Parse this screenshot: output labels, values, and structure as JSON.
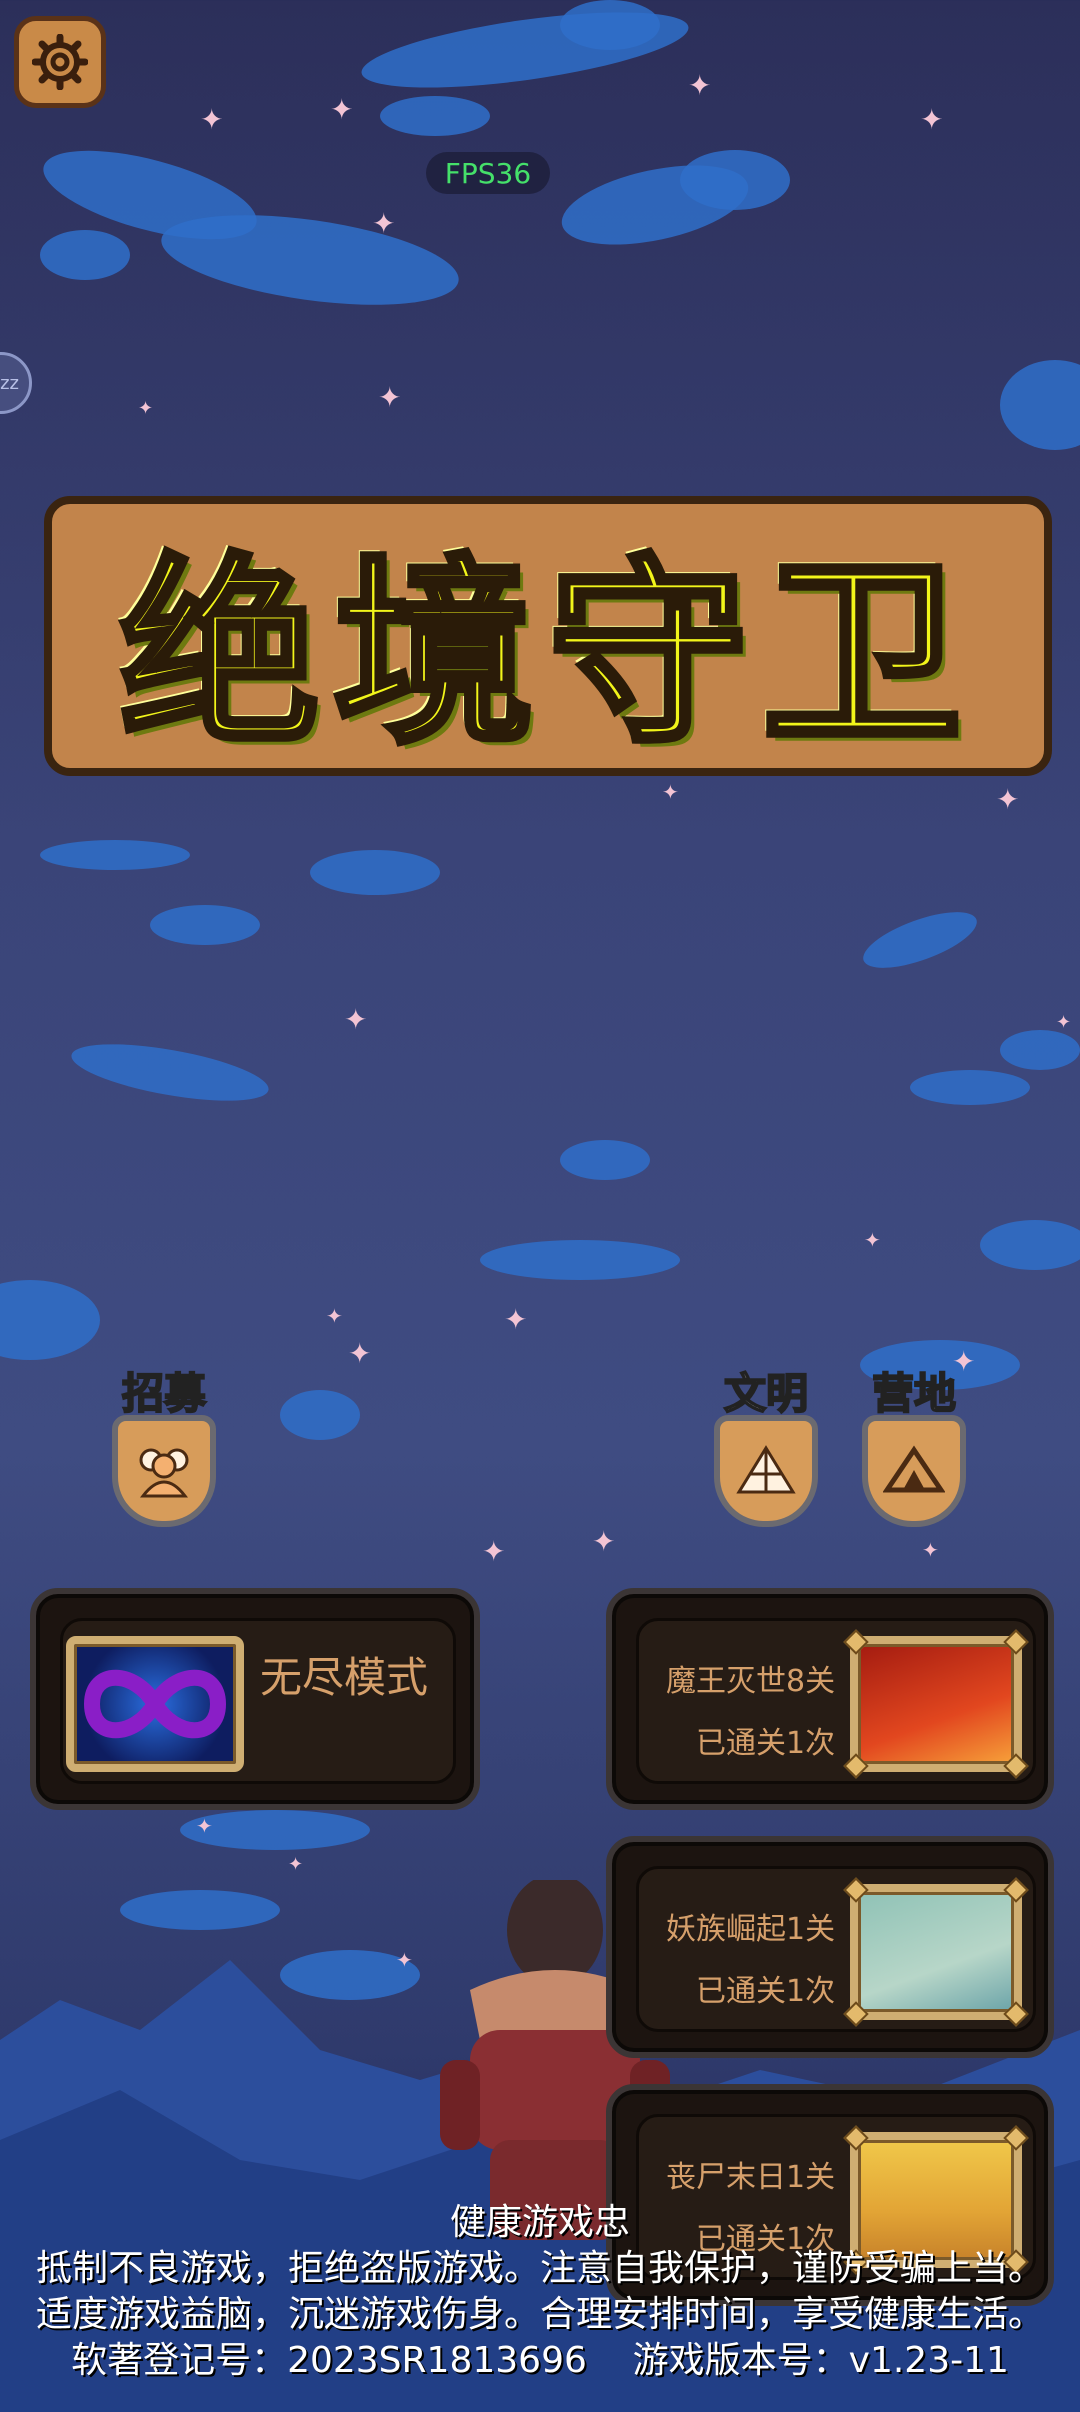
{
  "hud": {
    "fps": "FPS36",
    "side_bubble": "zz"
  },
  "title": "绝境守卫",
  "menu": [
    {
      "label": "招募",
      "icon": "recruit-icon"
    },
    {
      "label": "文明",
      "icon": "civilization-icon"
    },
    {
      "label": "营地",
      "icon": "camp-icon"
    }
  ],
  "endless": {
    "label": "无尽模式",
    "icon": "infinity-icon"
  },
  "stages": [
    {
      "name": "魔王灭世8关",
      "cleared": "已通关1次",
      "thumb": "fire-scene-icon"
    },
    {
      "name": "妖族崛起1关",
      "cleared": "已通关1次",
      "thumb": "map-scene-icon"
    },
    {
      "name": "丧尸末日1关",
      "cleared": "已通关1次",
      "thumb": "desert-road-icon"
    }
  ],
  "footer": {
    "heading": "健康游戏忠",
    "line1": "抵制不良游戏，拒绝盗版游戏。注意自我保护，谨防受骗上当。",
    "line2": "适度游戏益脑，沉迷游戏伤身。合理安排时间，享受健康生活。",
    "line3": "软著登记号：2023SR1813696    游戏版本号：v1.23-11"
  },
  "colors": {
    "title_fill": "#f2f51a",
    "panel_text": "#d6a06b",
    "fps_text": "#45e06a"
  }
}
